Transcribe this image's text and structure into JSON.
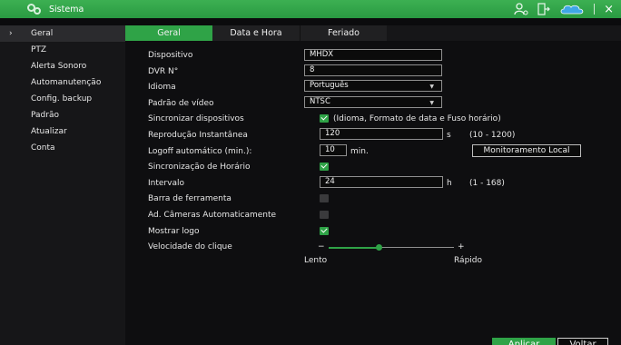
{
  "app": {
    "title": "Sistema"
  },
  "sidebar": {
    "items": [
      {
        "label": "Geral",
        "active": true
      },
      {
        "label": "PTZ"
      },
      {
        "label": "Alerta Sonoro"
      },
      {
        "label": "Automanutenção"
      },
      {
        "label": "Config. backup"
      },
      {
        "label": "Padrão"
      },
      {
        "label": "Atualizar"
      },
      {
        "label": "Conta"
      }
    ]
  },
  "tabs": [
    {
      "label": "Geral",
      "active": true
    },
    {
      "label": "Data e Hora"
    },
    {
      "label": "Feriado"
    }
  ],
  "form": {
    "dispositivo": {
      "label": "Dispositivo",
      "value": "MHDX"
    },
    "dvr_no": {
      "label": "DVR N°",
      "value": "8"
    },
    "idioma": {
      "label": "Idioma",
      "value": "Português"
    },
    "padrao_video": {
      "label": "Padrão de vídeo",
      "value": "NTSC"
    },
    "sincronizar": {
      "label": "Sincronizar dispositivos",
      "checked": true,
      "note": "(Idioma, Formato de data e Fuso horário)"
    },
    "reproducao": {
      "label": "Reprodução Instantânea",
      "value": "120",
      "unit": "s",
      "range": "(10 - 1200)"
    },
    "logoff": {
      "label": "Logoff automático (min.):",
      "value": "10",
      "unit": "min.",
      "button": "Monitoramento Local"
    },
    "sinc_horario": {
      "label": "Sincronização de Horário",
      "checked": true
    },
    "intervalo": {
      "label": "Intervalo",
      "value": "24",
      "unit": "h",
      "range": "(1 - 168)"
    },
    "barra_ferramenta": {
      "label": "Barra de ferramenta",
      "checked": false
    },
    "ad_cameras": {
      "label": "Ad. Câmeras Automaticamente",
      "checked": false
    },
    "mostrar_logo": {
      "label": "Mostrar logo",
      "checked": true
    },
    "velocidade": {
      "label": "Velocidade do clique",
      "min_label": "Lento",
      "max_label": "Rápido",
      "min_symbol": "−",
      "max_symbol": "+",
      "level": 0.4
    }
  },
  "footer": {
    "apply": "Aplicar",
    "back": "Voltar"
  },
  "colors": {
    "accent": "#2fa347",
    "topbar": "#35a84c"
  },
  "icons": {
    "close": "×"
  }
}
